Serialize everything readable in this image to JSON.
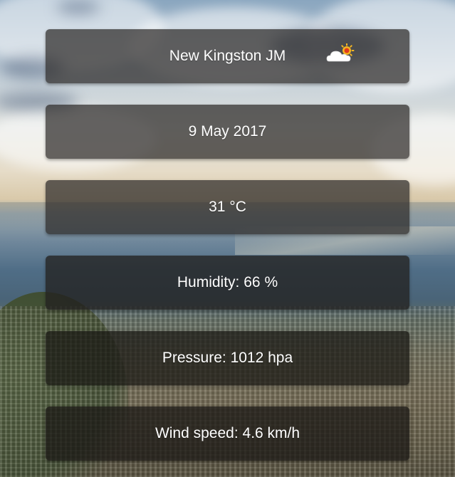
{
  "location": {
    "city": "New Kingston JM",
    "weather_icon": "partly-cloudy-sun-icon"
  },
  "date": "9 May 2017",
  "temperature": "31 °C",
  "humidity": {
    "label": "Humidity:",
    "value": "66 %"
  },
  "pressure": {
    "label": "Pressure:",
    "value": "1012 hpa"
  },
  "wind": {
    "label": "Wind speed:",
    "value": "4.6 km/h"
  },
  "colors": {
    "card_background": "#2d2a28",
    "text": "#ffffff",
    "sun": "#f5b622",
    "sun_core": "#e03a1e"
  }
}
